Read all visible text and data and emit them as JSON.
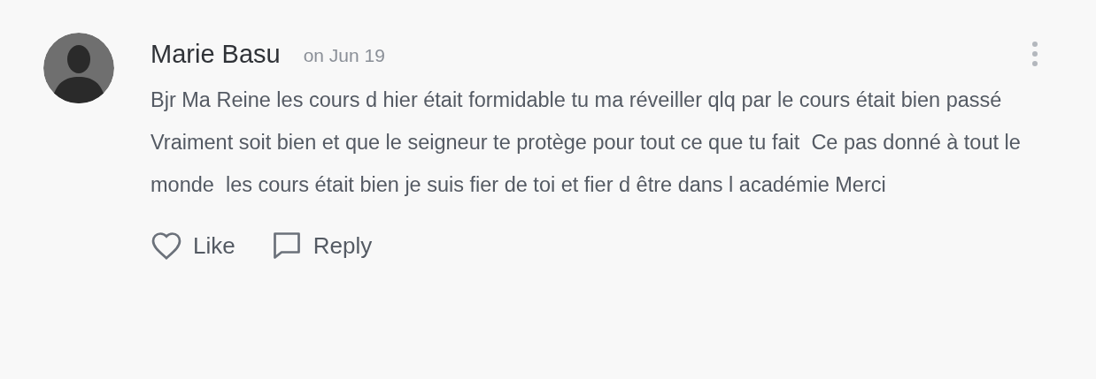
{
  "comment": {
    "author": "Marie Basu",
    "date": "on Jun 19",
    "paragraphs": [
      "Bjr Ma Reine les cours d hier était formidable tu ma réveiller qlq par le cours était bien passé",
      "Vraiment soit bien et que le seigneur te protège pour tout ce que tu fait  Ce pas donné à tout le monde  les cours était bien je suis fier de toi et fier d être dans l académie Merci"
    ],
    "actions": [
      {
        "kind": "like",
        "label": "Like"
      },
      {
        "kind": "reply",
        "label": "Reply"
      }
    ]
  }
}
